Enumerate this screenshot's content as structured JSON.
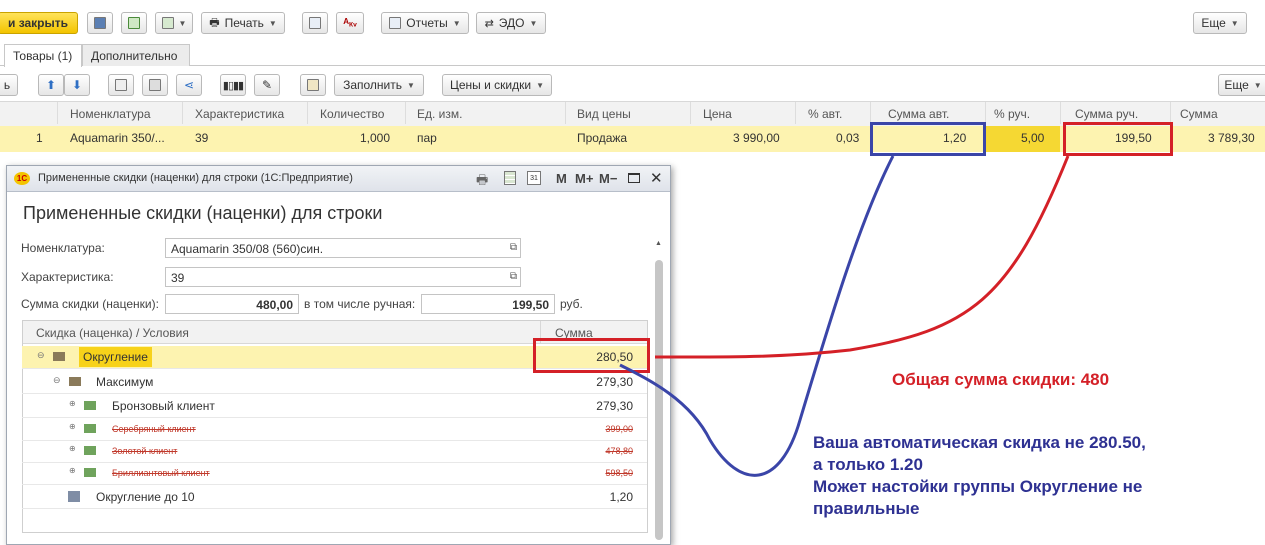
{
  "toolbar": {
    "save_close": "и закрыть",
    "print": "Печать",
    "reports": "Отчеты",
    "edo": "ЭДО",
    "more": "Еще"
  },
  "tabs": [
    {
      "label": "Товары (1)"
    },
    {
      "label": "Дополнительно"
    }
  ],
  "table_toolbar": {
    "fill": "Заполнить",
    "prices_discounts": "Цены и скидки",
    "more": "Еще",
    "left_stub": "ь"
  },
  "table": {
    "columns": [
      "Номенклатура",
      "Характеристика",
      "Количество",
      "Ед. изм.",
      "Вид цены",
      "Цена",
      "% авт.",
      "Сумма авт.",
      "% руч.",
      "Сумма руч.",
      "Сумма"
    ],
    "row": {
      "n": "1",
      "nomenclature": "Aquamarin 350/...",
      "characteristic": "39",
      "quantity": "1,000",
      "unit": "пар",
      "price_type": "Продажа",
      "price": "3 990,00",
      "pct_auto": "0,03",
      "sum_auto": "1,20",
      "pct_manual": "5,00",
      "sum_manual": "199,50",
      "sum": "3 789,30"
    }
  },
  "dialog": {
    "window_title": "Примененные скидки (наценки) для строки  (1С:Предприятие)",
    "window_buttons": {
      "m": "M",
      "mplus": "M+",
      "mminus": "M−"
    },
    "heading": "Примененные скидки (наценки) для строки",
    "nomenclature_label": "Номенклатура:",
    "nomenclature_value": "Aquamarin 350/08 (560)син.",
    "characteristic_label": "Характеристика:",
    "characteristic_value": "39",
    "discount_sum_label": "Сумма скидки (наценки):",
    "discount_sum_value": "480,00",
    "manual_label": "в том числе ручная:",
    "manual_value": "199,50",
    "currency": "руб.",
    "tree_header": {
      "name": "Скидка (наценка) / Условия",
      "sum": "Сумма"
    },
    "tree": [
      {
        "label": "Округление",
        "value": "280,50"
      },
      {
        "label": "Максимум",
        "value": "279,30"
      },
      {
        "label": "Бронзовый клиент",
        "value": "279,30"
      },
      {
        "label": "Серебряный клиент",
        "value": "399,00"
      },
      {
        "label": "Золотой клиент",
        "value": "478,80"
      },
      {
        "label": "Бриллиантовый клиент",
        "value": "598,50"
      },
      {
        "label": "Округление до 10",
        "value": "1,20"
      }
    ]
  },
  "annotations": {
    "total": "Общая сумма скидки: 480",
    "auto_line1": "Ваша автоматическая скидка не 280.50,",
    "auto_line2": "а только 1.20",
    "auto_line3": "Может настойки группы Округление не",
    "auto_line4": "правильные"
  },
  "colors": {
    "highlight": "#fdf3b0",
    "selected_cell": "#f5d833",
    "accent_yellow": "#f7d21a",
    "red": "#d42027",
    "blue": "#3a45a8",
    "annotation_red": "#d42027",
    "annotation_blue": "#2e3192"
  }
}
